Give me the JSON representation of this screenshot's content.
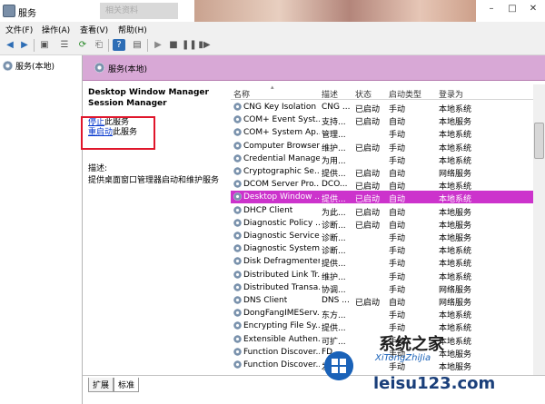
{
  "window": {
    "title": "服务",
    "blurred_text": "相关资料"
  },
  "menu": [
    "文件(F)",
    "操作(A)",
    "查看(V)",
    "帮助(H)"
  ],
  "tree": {
    "root": "服务(本地)"
  },
  "header": {
    "title": "服务(本地)"
  },
  "detail": {
    "service_name": "Desktop Window Manager Session Manager",
    "stop_link": "停止",
    "stop_suffix": "此服务",
    "restart_link": "重启动",
    "restart_suffix": "此服务",
    "desc_label": "描述:",
    "desc_text": "提供桌面窗口管理器启动和维护服务"
  },
  "columns": [
    "名称",
    "描述",
    "状态",
    "启动类型",
    "登录为"
  ],
  "rows": [
    {
      "name": "CNG Key Isolation",
      "desc": "CNG ...",
      "status": "已启动",
      "startup": "手动",
      "logon": "本地系统"
    },
    {
      "name": "COM+ Event Syst...",
      "desc": "支持...",
      "status": "已启动",
      "startup": "自动",
      "logon": "本地服务"
    },
    {
      "name": "COM+ System Ap...",
      "desc": "管理...",
      "status": "",
      "startup": "手动",
      "logon": "本地系统"
    },
    {
      "name": "Computer Browser",
      "desc": "维护...",
      "status": "已启动",
      "startup": "手动",
      "logon": "本地系统"
    },
    {
      "name": "Credential Manager",
      "desc": "为用...",
      "status": "",
      "startup": "手动",
      "logon": "本地系统"
    },
    {
      "name": "Cryptographic Se...",
      "desc": "提供...",
      "status": "已启动",
      "startup": "自动",
      "logon": "网络服务"
    },
    {
      "name": "DCOM Server Pro...",
      "desc": "DCO...",
      "status": "已启动",
      "startup": "自动",
      "logon": "本地系统"
    },
    {
      "name": "Desktop Window ...",
      "desc": "提供...",
      "status": "已启动",
      "startup": "自动",
      "logon": "本地系统"
    },
    {
      "name": "DHCP Client",
      "desc": "为此...",
      "status": "已启动",
      "startup": "自动",
      "logon": "本地服务"
    },
    {
      "name": "Diagnostic Policy ...",
      "desc": "诊断...",
      "status": "已启动",
      "startup": "自动",
      "logon": "本地服务"
    },
    {
      "name": "Diagnostic Service...",
      "desc": "诊断...",
      "status": "",
      "startup": "手动",
      "logon": "本地服务"
    },
    {
      "name": "Diagnostic System...",
      "desc": "诊断...",
      "status": "",
      "startup": "手动",
      "logon": "本地系统"
    },
    {
      "name": "Disk Defragmenter",
      "desc": "提供...",
      "status": "",
      "startup": "手动",
      "logon": "本地系统"
    },
    {
      "name": "Distributed Link Tr...",
      "desc": "维护...",
      "status": "",
      "startup": "手动",
      "logon": "本地系统"
    },
    {
      "name": "Distributed Transa...",
      "desc": "协调...",
      "status": "",
      "startup": "手动",
      "logon": "网络服务"
    },
    {
      "name": "DNS Client",
      "desc": "DNS ...",
      "status": "已启动",
      "startup": "自动",
      "logon": "网络服务"
    },
    {
      "name": "DongFangIMEServ...",
      "desc": "东方...",
      "status": "",
      "startup": "手动",
      "logon": "本地系统"
    },
    {
      "name": "Encrypting File Sy...",
      "desc": "提供...",
      "status": "",
      "startup": "手动",
      "logon": "本地系统"
    },
    {
      "name": "Extensible Authen...",
      "desc": "可扩...",
      "status": "",
      "startup": "手动",
      "logon": "本地系统"
    },
    {
      "name": "Function Discover...",
      "desc": "FD...",
      "status": "",
      "startup": "手动",
      "logon": "本地服务"
    },
    {
      "name": "Function Discover...",
      "desc": "发布...",
      "status": "",
      "startup": "手动",
      "logon": "本地服务"
    }
  ],
  "selected_row": 7,
  "tabs": [
    "扩展",
    "标准"
  ],
  "watermark": {
    "line1": "系统之家",
    "line2": "XiTongZhiJia",
    "line3": "leisu123.com"
  }
}
